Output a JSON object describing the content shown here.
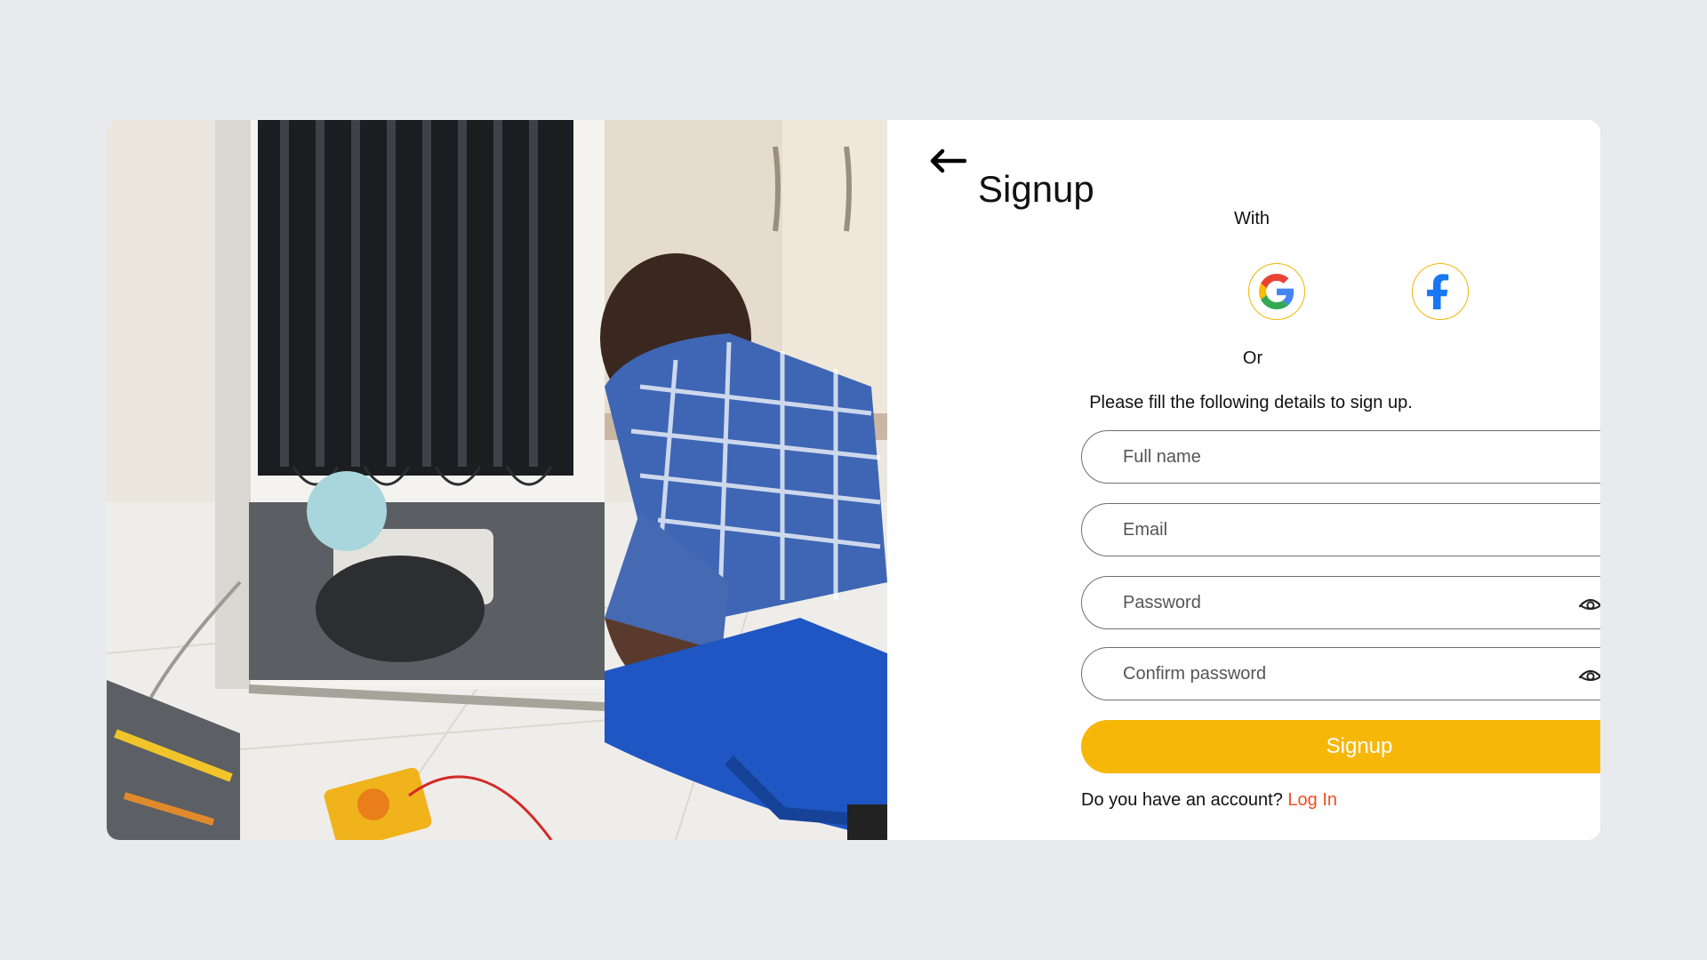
{
  "signup": {
    "title": "Signup",
    "with_label": "With",
    "or_label": "Or",
    "instructions": "Please fill the following details to sign up.",
    "fields": {
      "full_name": {
        "placeholder": "Full name",
        "value": ""
      },
      "email": {
        "placeholder": "Email",
        "value": ""
      },
      "password": {
        "placeholder": "Password",
        "value": ""
      },
      "confirm_password": {
        "placeholder": "Confirm password",
        "value": ""
      }
    },
    "submit_label": "Signup",
    "account_prompt": "Do you have an account?",
    "login_link": "Log In"
  },
  "icons": {
    "back": "arrow-left-icon",
    "google": "google-icon",
    "facebook": "facebook-icon",
    "eye": "eye-icon"
  },
  "colors": {
    "accent": "#f7b708",
    "link": "#f04e1f",
    "facebook_blue": "#1877f2",
    "background": "#e8eaed"
  }
}
